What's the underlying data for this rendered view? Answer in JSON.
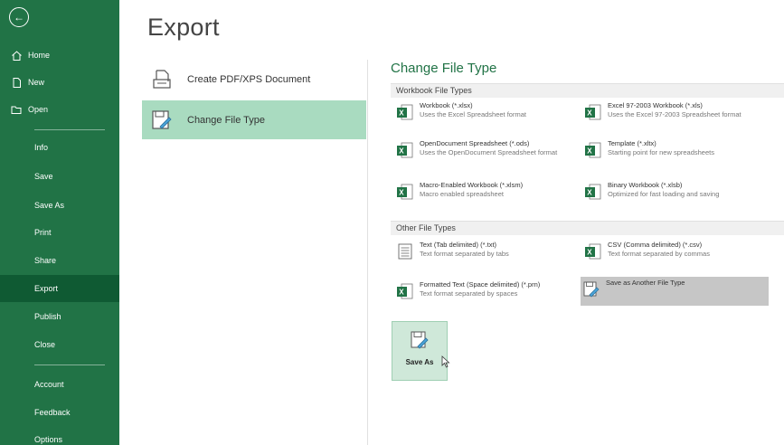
{
  "sidebar": {
    "top_items": [
      {
        "label": "Home",
        "icon": "home-icon"
      },
      {
        "label": "New",
        "icon": "new-doc-icon"
      },
      {
        "label": "Open",
        "icon": "open-folder-icon"
      }
    ],
    "items": [
      "Info",
      "Save",
      "Save As",
      "Print",
      "Share",
      "Export",
      "Publish",
      "Close"
    ],
    "bottom_items": [
      "Account",
      "Feedback",
      "Options"
    ],
    "active": "Export",
    "bg_color": "#217346",
    "active_color": "#0f5a33"
  },
  "page_title": "Export",
  "export_options": [
    {
      "label": "Create PDF/XPS Document",
      "icon": "pdf-document-icon"
    },
    {
      "label": "Change File Type",
      "icon": "change-file-type-icon",
      "selected": true
    }
  ],
  "change_file_type": {
    "title": "Change File Type",
    "workbook_header": "Workbook File Types",
    "workbook_types": [
      {
        "name": "Workbook (*.xlsx)",
        "desc": "Uses the Excel Spreadsheet format"
      },
      {
        "name": "Excel 97-2003 Workbook (*.xls)",
        "desc": "Uses the Excel 97-2003 Spreadsheet format"
      },
      {
        "name": "OpenDocument Spreadsheet (*.ods)",
        "desc": "Uses the OpenDocument Spreadsheet format"
      },
      {
        "name": "Template (*.xltx)",
        "desc": "Starting point for new spreadsheets"
      },
      {
        "name": "Macro-Enabled Workbook (*.xlsm)",
        "desc": "Macro enabled spreadsheet"
      },
      {
        "name": "Binary Workbook (*.xlsb)",
        "desc": "Optimized for fast loading and saving"
      }
    ],
    "other_header": "Other File Types",
    "other_types": [
      {
        "name": "Text (Tab delimited) (*.txt)",
        "desc": "Text format separated by tabs"
      },
      {
        "name": "CSV (Comma delimited) (*.csv)",
        "desc": "Text format separated by commas"
      },
      {
        "name": "Formatted Text (Space delimited) (*.prn)",
        "desc": "Text format separated by spaces"
      },
      {
        "name": "Save as Another File Type",
        "desc": ""
      }
    ],
    "save_as_label": "Save As",
    "accent_color": "#217346"
  }
}
